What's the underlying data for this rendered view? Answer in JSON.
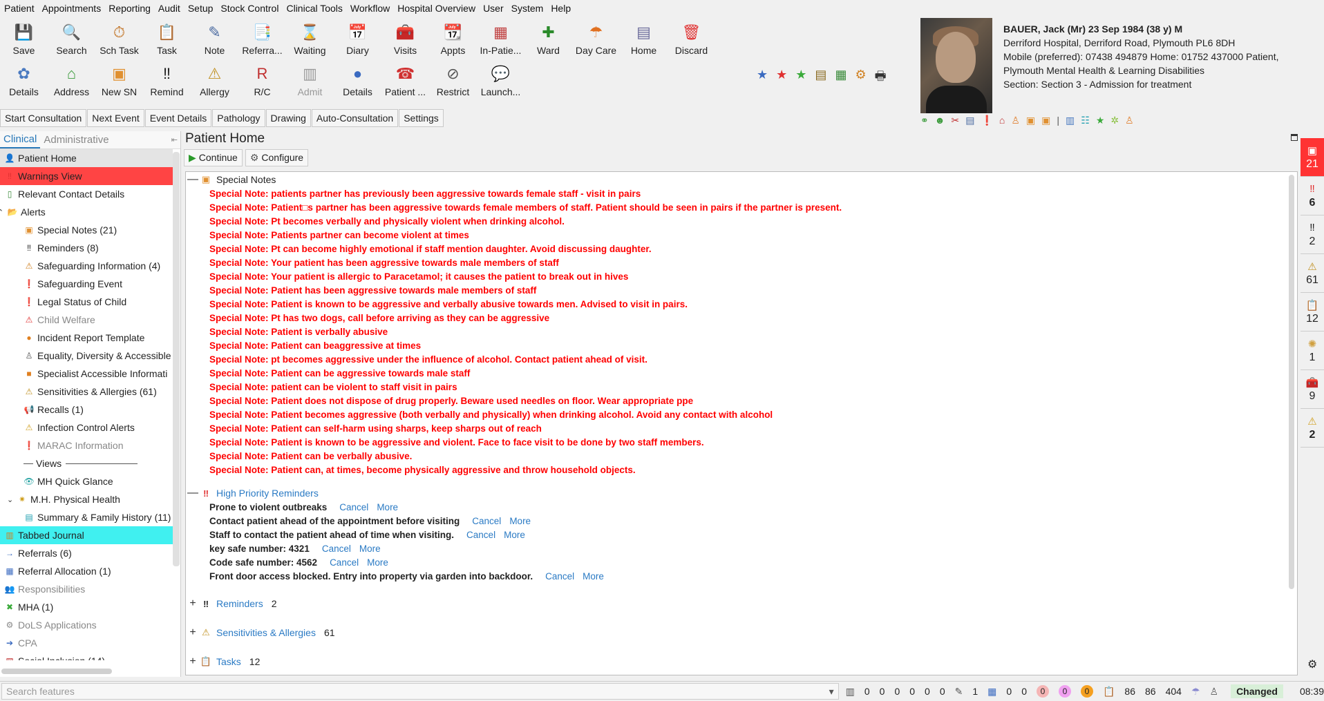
{
  "menu": [
    "Patient",
    "Appointments",
    "Reporting",
    "Audit",
    "Setup",
    "Stock Control",
    "Clinical Tools",
    "Workflow",
    "Hospital Overview",
    "User",
    "System",
    "Help"
  ],
  "toolbar": {
    "row1": [
      {
        "label": "Save",
        "icon": "save-icon",
        "glyph": "💾",
        "color": "#2a8a2a"
      },
      {
        "label": "Search",
        "icon": "search-icon",
        "glyph": "🔍",
        "color": "#555"
      },
      {
        "label": "Sch Task",
        "icon": "schedule-task-icon",
        "glyph": "⏱",
        "color": "#c07020"
      },
      {
        "label": "Task",
        "icon": "task-icon",
        "glyph": "📋",
        "color": "#d09030"
      },
      {
        "label": "Note",
        "icon": "note-icon",
        "glyph": "✎",
        "color": "#4a6aa0"
      },
      {
        "label": "Referra...",
        "icon": "referral-icon",
        "glyph": "📑",
        "color": "#4a7ac0"
      },
      {
        "label": "Waiting",
        "icon": "waiting-icon",
        "glyph": "⌛",
        "color": "#3a6ab0"
      },
      {
        "label": "Diary",
        "icon": "diary-icon",
        "glyph": "📅",
        "color": "#c03030"
      },
      {
        "label": "Visits",
        "icon": "visits-icon",
        "glyph": "🧰",
        "color": "#20b0c0"
      },
      {
        "label": "Appts",
        "icon": "appointments-icon",
        "glyph": "📆",
        "color": "#d08020"
      },
      {
        "label": "In-Patie...",
        "icon": "in-patient-icon",
        "glyph": "▦",
        "color": "#c04040"
      },
      {
        "label": "Ward",
        "icon": "ward-icon",
        "glyph": "✚",
        "color": "#2a8a2a"
      },
      {
        "label": "Day Care",
        "icon": "day-care-icon",
        "glyph": "☂",
        "color": "#e07020"
      },
      {
        "label": "Home",
        "icon": "home-icon",
        "glyph": "▤",
        "color": "#6a6a9a"
      },
      {
        "label": "Discard",
        "icon": "discard-icon",
        "glyph": "🗑",
        "color": "#e03030"
      }
    ],
    "row2": [
      {
        "label": "Details",
        "icon": "details-icon",
        "glyph": "✿",
        "color": "#4a7ac0",
        "disabled": false
      },
      {
        "label": "Address",
        "icon": "address-icon",
        "glyph": "⌂",
        "color": "#3a9a3a",
        "disabled": false
      },
      {
        "label": "New SN",
        "icon": "new-special-note-icon",
        "glyph": "▣",
        "color": "#e09030",
        "disabled": false
      },
      {
        "label": "Remind",
        "icon": "remind-icon",
        "glyph": "‼",
        "color": "#222",
        "disabled": false
      },
      {
        "label": "Allergy",
        "icon": "allergy-icon",
        "glyph": "⚠",
        "color": "#c09020",
        "disabled": false
      },
      {
        "label": "R/C",
        "icon": "rc-icon",
        "glyph": "R",
        "color": "#c03030",
        "disabled": false
      },
      {
        "label": "Admit",
        "icon": "admit-icon",
        "glyph": "▥",
        "color": "#999",
        "disabled": true
      },
      {
        "label": "Details",
        "icon": "circle-details-icon",
        "glyph": "●",
        "color": "#3a6ac0",
        "disabled": false
      },
      {
        "label": "Patient ...",
        "icon": "patient-phone-icon",
        "glyph": "☎",
        "color": "#d03030",
        "disabled": false
      },
      {
        "label": "Restrict",
        "icon": "restrict-icon",
        "glyph": "⊘",
        "color": "#555",
        "disabled": false
      },
      {
        "label": "Launch...",
        "icon": "launch-icon",
        "glyph": "💬",
        "color": "#8a6ad0",
        "disabled": false
      }
    ],
    "extra_icons": [
      "★",
      "★",
      "★",
      "▤",
      "▦",
      "⚙",
      "🖶"
    ]
  },
  "patient": {
    "name": "BAUER, Jack (Mr) 23 Sep 1984 (38 y) M",
    "address": "Derriford Hospital, Derriford Road, Plymouth PL6 8DH",
    "phones": "Mobile (preferred): 07438 494879 Home: 01752 437000   Patient,",
    "org": "Plymouth Mental Health & Learning Disabilities",
    "section": "Section: Section 3 - Admission for treatment"
  },
  "subtabs": [
    "Start Consultation",
    "Next Event",
    "Event Details",
    "Pathology",
    "Drawing",
    "Auto-Consultation",
    "Settings"
  ],
  "left_tabs": [
    "Clinical",
    "Administrative"
  ],
  "left_items": [
    {
      "label": "Patient Home",
      "icon": "person-icon",
      "glyph": "👤",
      "indent": 0,
      "style": "selected"
    },
    {
      "label": "Warnings View",
      "icon": "warning-icon",
      "glyph": "‼",
      "indent": 0,
      "style": "warn"
    },
    {
      "label": "Relevant Contact Details",
      "icon": "contact-icon",
      "glyph": "▯",
      "indent": 0,
      "style": ""
    },
    {
      "label": "Alerts",
      "icon": "folder-icon",
      "glyph": "📂",
      "indent": 0,
      "style": "",
      "toggle": "^"
    },
    {
      "label": "Special Notes (21)",
      "icon": "special-note-icon",
      "glyph": "▣",
      "indent": 2,
      "style": ""
    },
    {
      "label": "Reminders (8)",
      "icon": "reminder-icon",
      "glyph": "‼",
      "indent": 2,
      "style": ""
    },
    {
      "label": "Safeguarding Information (4)",
      "icon": "safeguarding-icon",
      "glyph": "⚠",
      "indent": 2,
      "style": ""
    },
    {
      "label": "Safeguarding Event",
      "icon": "alert-icon",
      "glyph": "❗",
      "indent": 2,
      "style": ""
    },
    {
      "label": "Legal Status of Child",
      "icon": "alert-icon",
      "glyph": "❗",
      "indent": 2,
      "style": ""
    },
    {
      "label": "Child Welfare",
      "icon": "triangle-warning-icon",
      "glyph": "⚠",
      "indent": 2,
      "style": "muted"
    },
    {
      "label": "Incident Report Template",
      "icon": "orange-dot-icon",
      "glyph": "●",
      "indent": 2,
      "style": ""
    },
    {
      "label": "Equality, Diversity & Accessible",
      "icon": "person-outline-icon",
      "glyph": "♙",
      "indent": 2,
      "style": ""
    },
    {
      "label": "Specialist Accessible Informati",
      "icon": "orange-square-icon",
      "glyph": "■",
      "indent": 2,
      "style": ""
    },
    {
      "label": "Sensitivities & Allergies (61)",
      "icon": "allergy-icon",
      "glyph": "⚠",
      "indent": 2,
      "style": ""
    },
    {
      "label": "Recalls (1)",
      "icon": "recall-icon",
      "glyph": "📢",
      "indent": 2,
      "style": ""
    },
    {
      "label": "Infection Control Alerts",
      "icon": "infection-warning-icon",
      "glyph": "⚠",
      "indent": 2,
      "style": ""
    },
    {
      "label": "MARAC Information",
      "icon": "alert-icon",
      "glyph": "❗",
      "indent": 2,
      "style": "muted"
    },
    {
      "label": "Views",
      "icon": "divider-icon",
      "glyph": "—",
      "indent": 2,
      "style": "",
      "divider": true
    },
    {
      "label": "MH Quick Glance",
      "icon": "eye-icon",
      "glyph": "👁",
      "indent": 2,
      "style": ""
    },
    {
      "label": "M.H. Physical Health",
      "icon": "star-folder-icon",
      "glyph": "✷",
      "indent": 1,
      "style": "",
      "toggle": "v"
    },
    {
      "label": "Summary & Family History (11)",
      "icon": "summary-icon",
      "glyph": "▤",
      "indent": 2,
      "style": ""
    },
    {
      "label": "Tabbed Journal",
      "icon": "journal-icon",
      "glyph": "▥",
      "indent": 0,
      "style": "cyan"
    },
    {
      "label": "Referrals (6)",
      "icon": "arrow-right-icon",
      "glyph": "→",
      "indent": 0,
      "style": ""
    },
    {
      "label": "Referral Allocation (1)",
      "icon": "allocation-icon",
      "glyph": "▦",
      "indent": 0,
      "style": ""
    },
    {
      "label": "Responsibilities",
      "icon": "people-icon",
      "glyph": "👥",
      "indent": 0,
      "style": "muted"
    },
    {
      "label": "MHA (1)",
      "icon": "cross-icon",
      "glyph": "✖",
      "indent": 0,
      "style": ""
    },
    {
      "label": "DoLS Applications",
      "icon": "dols-icon",
      "glyph": "⚙",
      "indent": 0,
      "style": "muted"
    },
    {
      "label": "CPA",
      "icon": "arrow-right-icon",
      "glyph": "➔",
      "indent": 0,
      "style": "muted"
    },
    {
      "label": "Social Inclusion (14)",
      "icon": "social-icon",
      "glyph": "▧",
      "indent": 0,
      "style": ""
    }
  ],
  "main": {
    "title": "Patient Home",
    "continue": "Continue",
    "configure": "Configure",
    "special_notes_title": "Special Notes",
    "special_notes": [
      "Special Note: patients partner has previously been aggressive towards female staff - visit in pairs",
      "Special Note: Patient□s partner has been aggressive towards female members of staff. Patient should be seen in pairs if the partner is present.",
      "Special Note: Pt becomes verbally and physically violent when drinking alcohol.",
      "Special Note: Patients partner can become violent at times",
      "Special Note: Pt can become highly emotional if staff mention daughter. Avoid discussing daughter.",
      "Special Note: Your patient has been aggressive towards male members of staff",
      "Special Note: Your patient is allergic to Paracetamol; it causes the patient to break out in hives",
      "Special Note: Patient has been aggressive towards male members of staff",
      "Special Note: Patient is known to be aggressive and verbally abusive towards men. Advised to visit in pairs.",
      "Special Note: Pt has two dogs, call before arriving as they can be aggressive",
      "Special Note: Patient is verbally abusive",
      "Special Note: Patient can beaggressive at times",
      "Special Note: pt becomes aggressive under the influence of alcohol. Contact patient ahead of visit.",
      "Special Note: Patient can be aggressive towards male staff",
      "Special Note: patient can be violent to staff visit in pairs",
      "Special Note: Patient does not dispose of drug properly. Beware used needles on floor. Wear appropriate ppe",
      "Special Note: Patient becomes aggressive (both verbally and physically) when drinking alcohol. Avoid any contact with alcohol",
      "Special Note: Patient can self-harm using sharps, keep sharps out of reach",
      "Special Note: Patient is known to be aggressive and violent. Face to face visit to be done by two staff members.",
      "Special Note: Patient can be verbally abusive.",
      "Special Note: Patient can, at times, become physically aggressive and throw household objects."
    ],
    "hpr_title": "High Priority Reminders",
    "hpr": [
      "Prone to violent outbreaks",
      "Contact patient ahead of the appointment before visiting",
      "Staff to contact the patient ahead of time when visiting.",
      "key safe number: 4321",
      "Code safe number: 4562",
      "Front door access blocked. Entry into property via garden into backdoor."
    ],
    "cancel": "Cancel",
    "more": "More",
    "reminders_title": "Reminders",
    "reminders_count": "2",
    "sens_title": "Sensitivities & Allergies",
    "sens_count": "61",
    "tasks_title": "Tasks",
    "tasks_count": "12"
  },
  "rightbar": [
    {
      "icon": "special-note-icon",
      "glyph": "▣",
      "num": "21",
      "red": true
    },
    {
      "icon": "reminder-red-icon",
      "glyph": "‼",
      "num": "6",
      "red": false,
      "bold": true
    },
    {
      "icon": "reminder-icon",
      "glyph": "‼",
      "num": "2",
      "red": false
    },
    {
      "icon": "allergy-icon",
      "glyph": "⚠",
      "num": "61",
      "red": false
    },
    {
      "icon": "task-icon",
      "glyph": "📋",
      "num": "12",
      "red": false
    },
    {
      "icon": "brain-icon",
      "glyph": "✺",
      "num": "1",
      "red": false
    },
    {
      "icon": "visits-icon",
      "glyph": "🧰",
      "num": "9",
      "red": false
    },
    {
      "icon": "warning-icon",
      "glyph": "⚠",
      "num": "2",
      "red": false,
      "bold": true
    }
  ],
  "status": {
    "search_placeholder": "Search features",
    "counts1": [
      "0",
      "0",
      "0",
      "0",
      "0",
      "0"
    ],
    "counts2": [
      "1",
      "0",
      "0"
    ],
    "dots": [
      "0",
      "0",
      "0"
    ],
    "counts3": [
      "86",
      "86",
      "404"
    ],
    "changed": "Changed",
    "time": "08:39"
  }
}
